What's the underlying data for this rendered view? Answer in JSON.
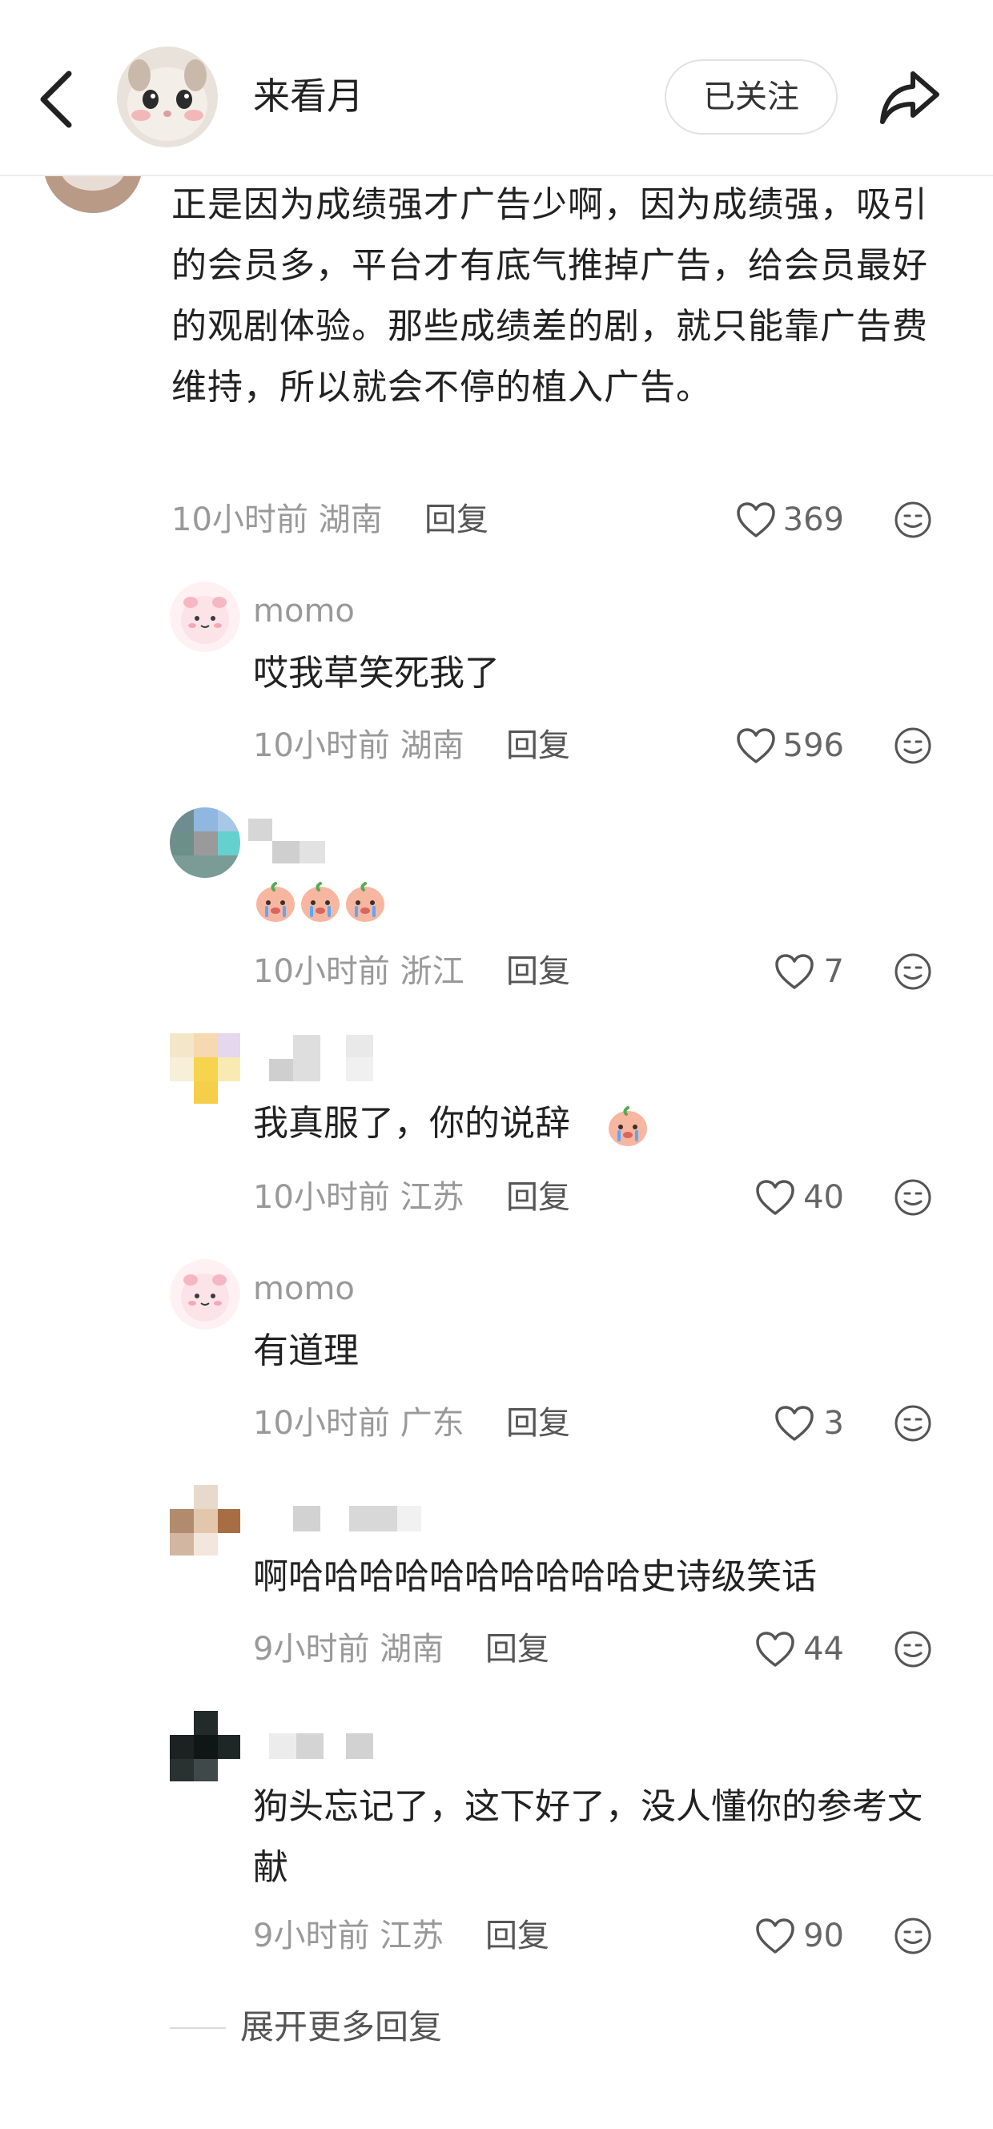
{
  "header": {
    "username": "来看月",
    "follow_label": "已关注"
  },
  "main_comment": {
    "text": "正是因为成绩强才广告少啊，因为成绩强，吸引的会员多，平台才有底气推掉广告，给会员最好的观剧体验。那些成绩差的剧，就只能靠广告费维持，所以就会不停的植入广告。",
    "time": "10小时前",
    "location": "湖南",
    "reply_label": "回复",
    "likes": "369"
  },
  "replies": [
    {
      "username": "momo",
      "text": "哎我草笑死我了",
      "time": "10小时前",
      "location": "湖南",
      "reply_label": "回复",
      "likes": "596"
    },
    {
      "username": "",
      "text": "",
      "time": "10小时前",
      "location": "浙江",
      "reply_label": "回复",
      "likes": "7",
      "emojis": [
        "crying-face-emoji",
        "crying-face-emoji",
        "crying-face-emoji"
      ]
    },
    {
      "username": "",
      "text": "我真服了，你的说辞",
      "time": "10小时前",
      "location": "江苏",
      "reply_label": "回复",
      "likes": "40"
    },
    {
      "username": "momo",
      "text": "有道理",
      "time": "10小时前",
      "location": "广东",
      "reply_label": "回复",
      "likes": "3"
    },
    {
      "username": "",
      "text": "啊哈哈哈哈哈哈哈哈哈哈史诗级笑话",
      "time": "9小时前",
      "location": "湖南",
      "reply_label": "回复",
      "likes": "44"
    },
    {
      "username": "",
      "text": "狗头忘记了，这下好了，没人懂你的参考文献",
      "time": "9小时前",
      "location": "江苏",
      "reply_label": "回复",
      "likes": "90"
    }
  ],
  "expand_more_label": "展开更多回复",
  "icons": {
    "back": "back-arrow-icon",
    "share": "share-icon",
    "like": "heart-outline-icon",
    "more": "smile-face-icon"
  },
  "colors": {
    "meta_text": "#999999",
    "body_text": "#222222",
    "divider": "#ececec"
  }
}
